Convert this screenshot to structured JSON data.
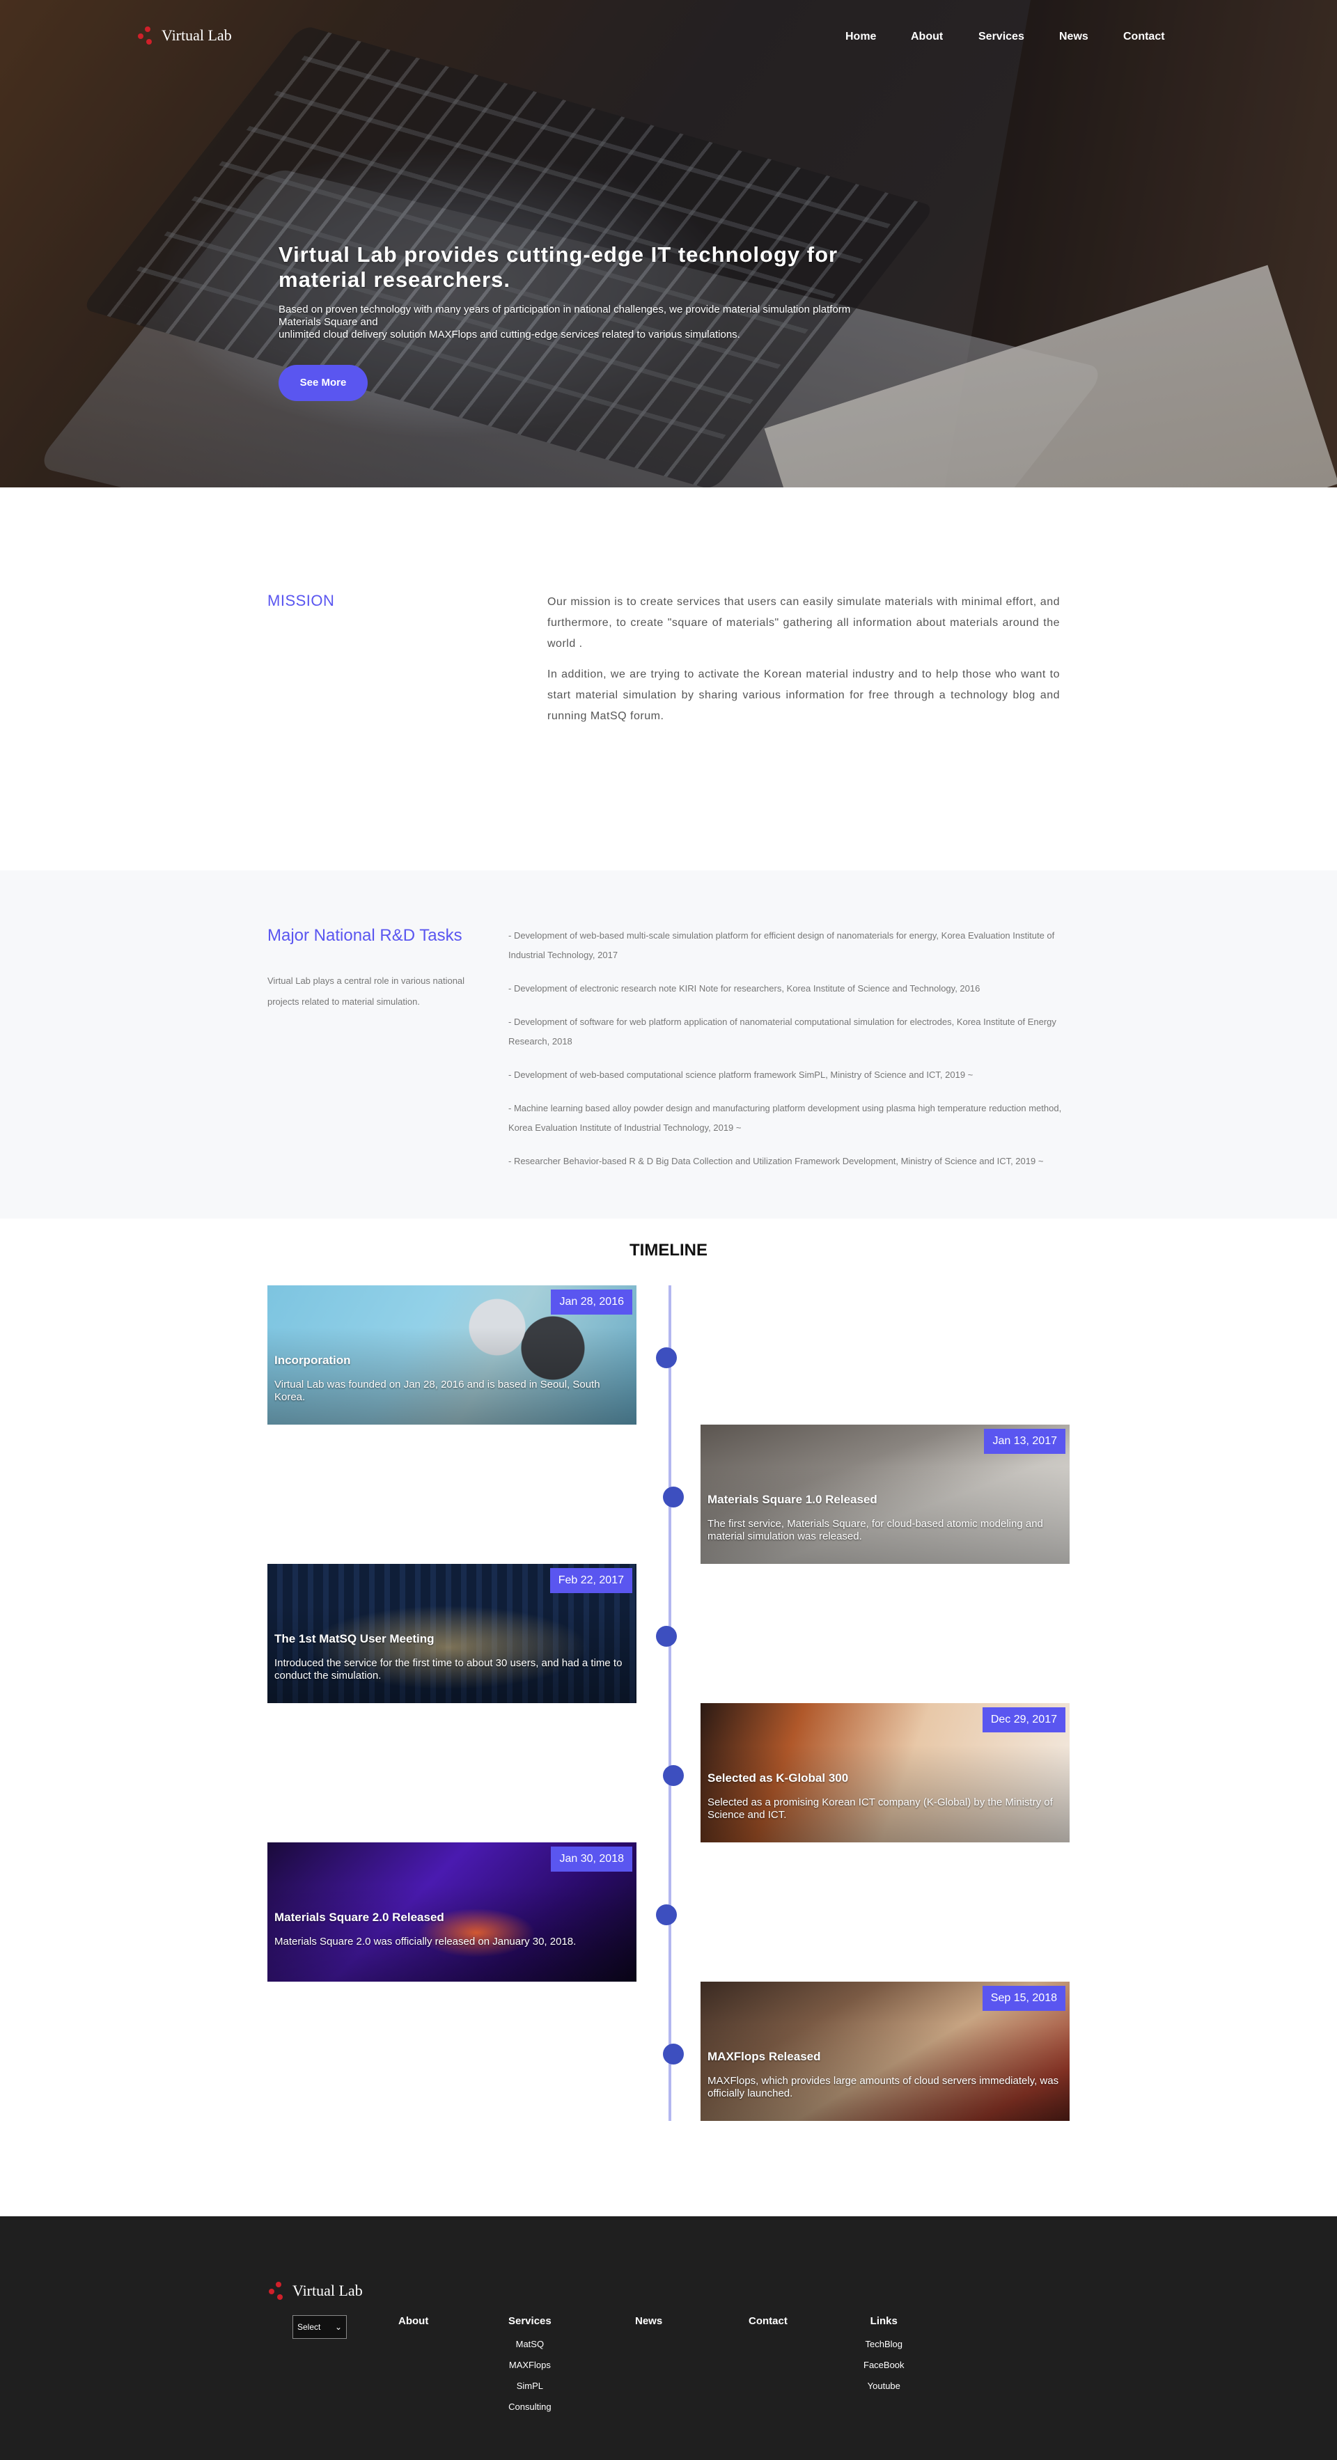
{
  "brand": {
    "name": "Virtual Lab",
    "accent": "#5a56f0",
    "logo_color": "#d0202a"
  },
  "nav": {
    "items": [
      {
        "label": "Home"
      },
      {
        "label": "About"
      },
      {
        "label": "Services"
      },
      {
        "label": "News"
      },
      {
        "label": "Contact"
      }
    ]
  },
  "hero": {
    "title": "Virtual Lab provides cutting-edge IT technology for material researchers.",
    "desc_line1": "Based on proven technology with many years of participation in national challenges, we provide material simulation platform",
    "desc_line2": "Materials Square and",
    "desc_line3": "unlimited cloud delivery solution MAXFlops and cutting-edge services related to various simulations.",
    "cta": "See More"
  },
  "mission": {
    "heading": "MISSION",
    "p1": "Our mission is to create services that users can easily simulate materials with minimal effort, and furthermore, to create \"square of materials\" gathering all information about materials around the world .",
    "p2": "In addition, we are trying to activate the Korean material industry and to help those who want to start material simulation by sharing various information for free through a technology blog and running MatSQ forum."
  },
  "rd": {
    "heading": "Major National R&D Tasks",
    "sub": "Virtual Lab plays a central role in various national projects related to material simulation.",
    "items": [
      "- Development of web-based multi-scale simulation platform for efficient design of nanomaterials for energy, Korea Evaluation Institute of Industrial Technology, 2017",
      "- Development of electronic research note KIRI Note for researchers, Korea Institute of Science and Technology, 2016",
      "- Development of software for web platform application of nanomaterial computational simulation for electrodes, Korea Institute of Energy Research, 2018",
      "- Development of web-based computational science platform framework SimPL, Ministry of Science and ICT, 2019 ~",
      "- Machine learning based alloy powder design and manufacturing platform development using plasma high temperature reduction method, Korea Evaluation Institute of Industrial Technology, 2019 ~",
      "- Researcher Behavior-based R & D Big Data Collection and Utilization Framework Development, Ministry of Science and ICT, 2019 ~"
    ]
  },
  "timeline": {
    "heading": "TIMELINE",
    "events": [
      {
        "date": "Jan 28, 2016",
        "title": "Incorporation",
        "desc": "Virtual Lab was founded on Jan 28, 2016 and is based in Seoul, South Korea."
      },
      {
        "date": "Jan 13, 2017",
        "title": "Materials Square 1.0 Released",
        "desc": "The first service, Materials Square, for cloud-based atomic modeling and material simulation was released."
      },
      {
        "date": "Feb 22, 2017",
        "title": "The 1st MatSQ User Meeting",
        "desc": "Introduced the service for the first time to about 30 users, and had a time to conduct the simulation."
      },
      {
        "date": "Dec 29, 2017",
        "title": "Selected as K-Global 300",
        "desc": "Selected as a promising Korean ICT company (K-Global) by the Ministry of Science and ICT."
      },
      {
        "date": "Jan 30, 2018",
        "title": "Materials Square 2.0 Released",
        "desc": "Materials Square 2.0 was officially released on January 30, 2018."
      },
      {
        "date": "Sep 15, 2018",
        "title": "MAXFlops Released",
        "desc": "MAXFlops, which provides large amounts of cloud servers immediately, was officially launched."
      }
    ]
  },
  "footer": {
    "brand": "Virtual Lab",
    "select_label": "Select",
    "about": "About",
    "services": {
      "heading": "Services",
      "items": [
        "MatSQ",
        "MAXFlops",
        "SimPL",
        "Consulting"
      ]
    },
    "news": "News",
    "contact": "Contact",
    "links": {
      "heading": "Links",
      "items": [
        "TechBlog",
        "FaceBook",
        "Youtube"
      ]
    }
  }
}
